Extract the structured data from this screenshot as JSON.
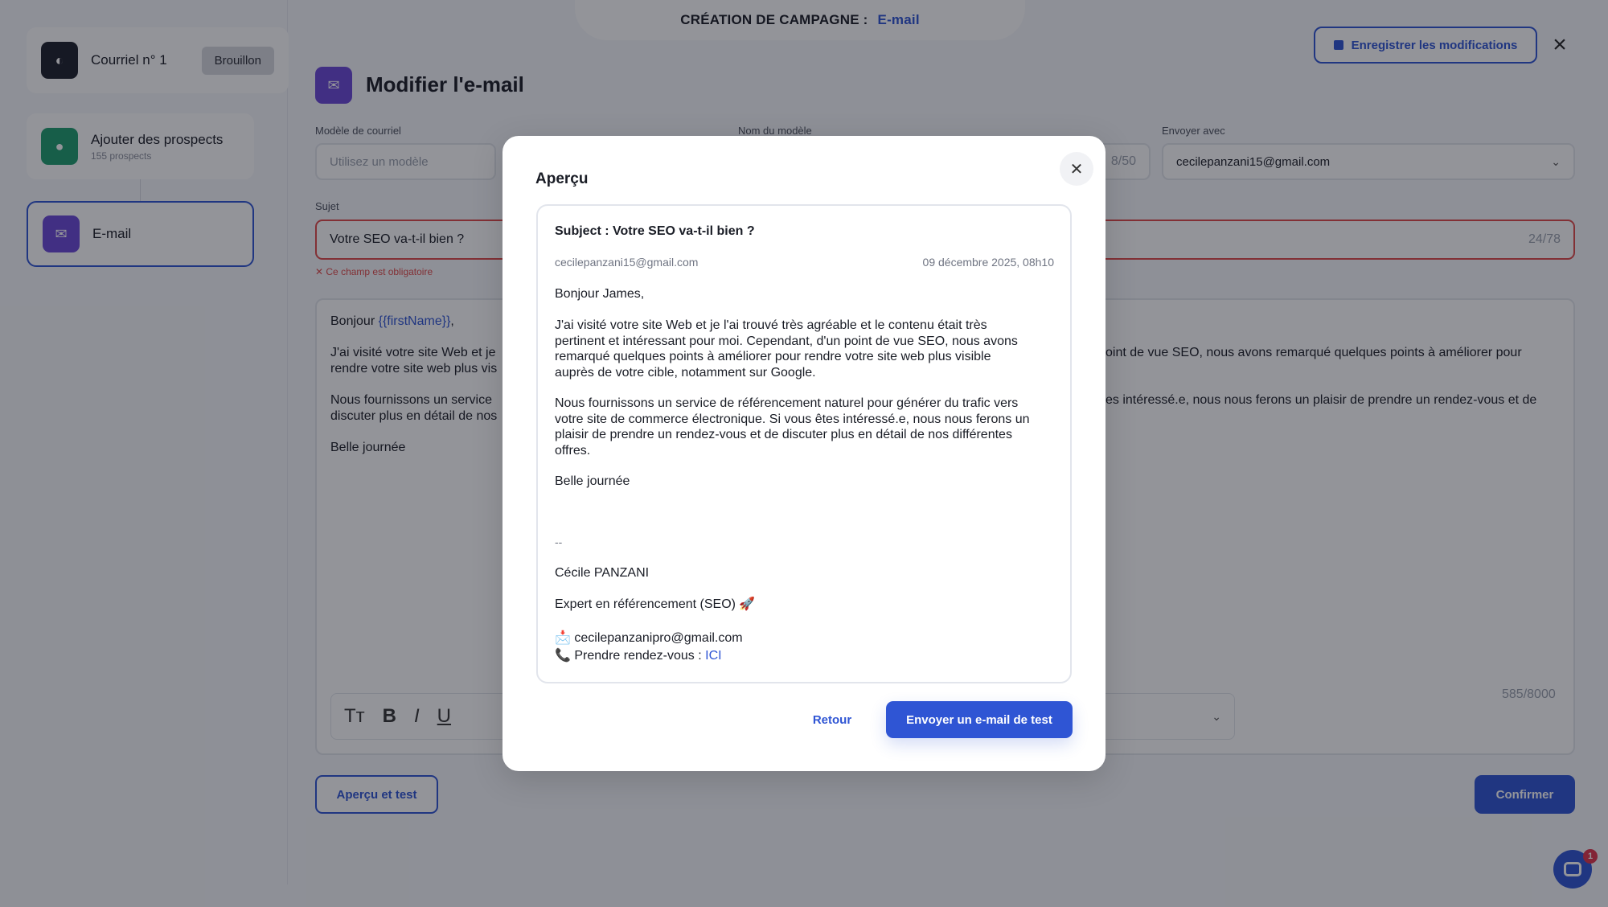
{
  "header": {
    "campaign_label": "CRÉATION DE CAMPAGNE :",
    "campaign_type": "E-mail",
    "save_label": "Enregistrer les modifications",
    "close_icon": "close-icon"
  },
  "sidebar": {
    "steps": [
      {
        "title": "Courriel n° 1",
        "badge": "Brouillon",
        "icon": "planet-icon"
      },
      {
        "title": "Ajouter des prospects",
        "subtitle": "155 prospects",
        "icon": "users-icon"
      },
      {
        "title": "E-mail",
        "icon": "mail-icon"
      }
    ]
  },
  "editor": {
    "title": "Modifier l'e-mail",
    "template_label": "Modèle de courriel",
    "template_placeholder": "Utilisez un modèle",
    "model_name_label": "Nom du modèle",
    "model_name_counter": "8/50",
    "send_with_label": "Envoyer avec",
    "send_with_value": "cecilepanzani15@gmail.com",
    "subject_label": "Sujet",
    "subject_value": "Votre SEO va-t-il bien ?",
    "subject_counter": "24/78",
    "error_message": "Ce champ est obligatoire",
    "body_greeting": "Bonjour ",
    "body_var": "{{firstName}}",
    "body_comma": ",",
    "body_l1_left": "J'ai visité votre site Web et je",
    "body_l1_right": "oint de vue SEO, nous avons remarqué quelques points à améliorer pour",
    "body_l2_left": "rendre votre site web plus vis",
    "body_l3_left": "Nous fournissons un service",
    "body_l3_right": "es intéressé.e, nous nous ferons un plaisir de prendre un rendez-vous et de",
    "body_l4_left": "discuter plus en détail de nos",
    "body_closing": "Belle journée",
    "body_counter": "585/8000",
    "preview_button": "Aperçu et test",
    "confirm_button": "Confirmer"
  },
  "chat": {
    "badge_count": "1"
  },
  "modal": {
    "title": "Aperçu",
    "subject": "Subject : Votre SEO va-t-il bien ?",
    "from": "cecilepanzani15@gmail.com",
    "date": "09 décembre 2025, 08h10",
    "greeting": "Bonjour James,",
    "p1": [
      "J'ai visité votre site Web et je l'ai trouvé très agréable et le contenu était très",
      "pertinent et intéressant pour moi. Cependant, d'un point de vue SEO, nous avons",
      "remarqué quelques points à améliorer pour rendre votre site web plus visible",
      "auprès de votre cible, notamment sur Google."
    ],
    "p2": [
      "Nous fournissons un service de référencement naturel pour générer du trafic vers",
      "votre site de commerce électronique. Si vous êtes intéressé.e, nous nous ferons un",
      "plaisir de prendre un rendez-vous et de discuter plus en détail de nos différentes",
      "offres."
    ],
    "closing": "Belle journée",
    "separator": "--",
    "sig_name": "Cécile PANZANI",
    "sig_title": "Expert en référencement (SEO) 🚀",
    "sig_email": "📩 cecilepanzanipro@gmail.com",
    "sig_phone_prefix": "📞 Prendre rendez-vous : ",
    "sig_phone_link": "ICI",
    "back_button": "Retour",
    "send_test_button": "Envoyer un e-mail de test"
  }
}
